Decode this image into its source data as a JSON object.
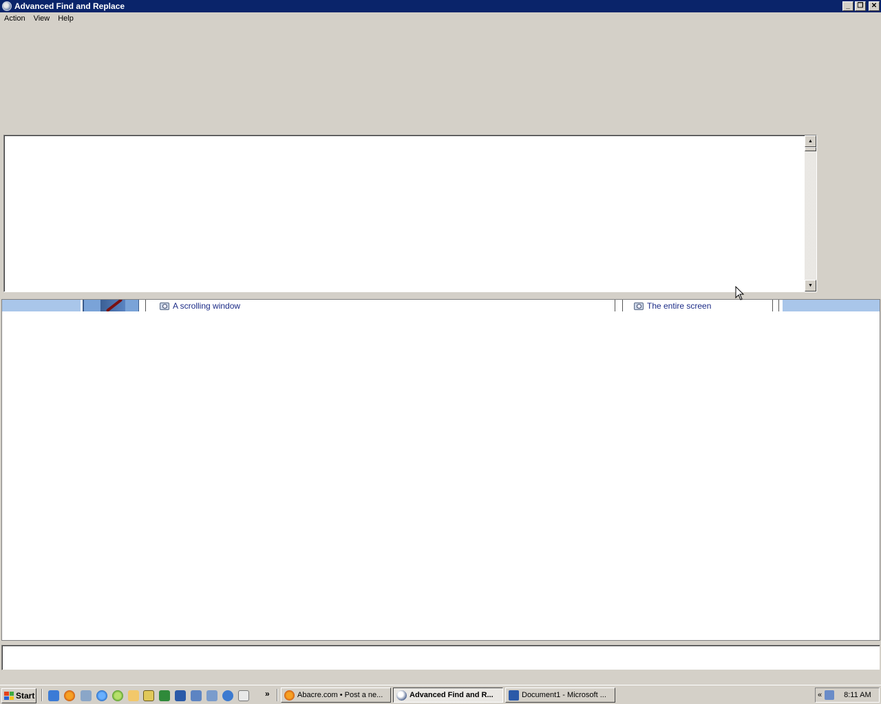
{
  "window": {
    "title": "Advanced Find and Replace"
  },
  "menu": [
    "Action",
    "View",
    "Help"
  ],
  "lower_pane": {
    "tab1_label": "A scrolling window",
    "tab2_label": "The entire screen"
  },
  "taskbar": {
    "start_label": "Start",
    "tasks": [
      {
        "label": "Abacre.com • Post a ne...",
        "icon": "firefox-icon"
      },
      {
        "label": "Advanced Find and R...",
        "icon": "find-replace-icon"
      },
      {
        "label": "Document1 - Microsoft ...",
        "icon": "word-icon"
      }
    ],
    "tray_chevron": "«",
    "clock": "8:11 AM",
    "quicklaunch_more": "»"
  },
  "colors": {
    "titlebar": "#0a246a",
    "strip_accent": "#a9c6ea",
    "link_text": "#1a2a86"
  }
}
